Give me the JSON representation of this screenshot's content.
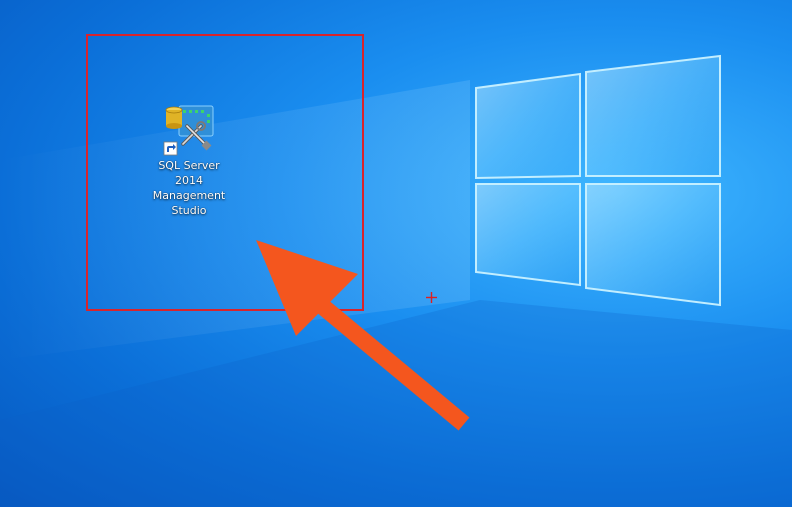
{
  "desktop": {
    "icons": [
      {
        "label": "SQL Server\n2014\nManagement\nStudio",
        "icon": "sql-server-management-studio-icon",
        "shortcut": true
      }
    ]
  },
  "annotation": {
    "box_color": "#d9242c",
    "arrow_color": "#f4561e"
  },
  "colors": {
    "desktop_background": "#1a8ef0",
    "cursor": "#e02020"
  }
}
